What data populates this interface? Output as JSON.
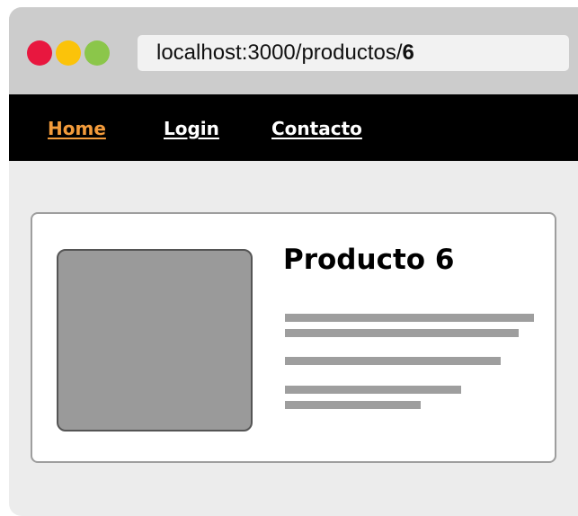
{
  "window": {
    "controls": [
      {
        "name": "close",
        "color": "#e8173f"
      },
      {
        "name": "minimize",
        "color": "#fbc30a"
      },
      {
        "name": "maximize",
        "color": "#8bc64a"
      }
    ]
  },
  "address_bar": {
    "url_prefix": "localhost:3000/productos/",
    "url_id": "6"
  },
  "nav": {
    "items": [
      {
        "label": "Home",
        "active": true,
        "color": "#f39b3b"
      },
      {
        "label": "Login",
        "active": false,
        "color": "#ffffff"
      },
      {
        "label": "Contacto",
        "active": false,
        "color": "#ffffff"
      }
    ]
  },
  "product": {
    "title": "Producto 6",
    "image_placeholder_color": "#9a9a9a",
    "description_lines": 5
  }
}
